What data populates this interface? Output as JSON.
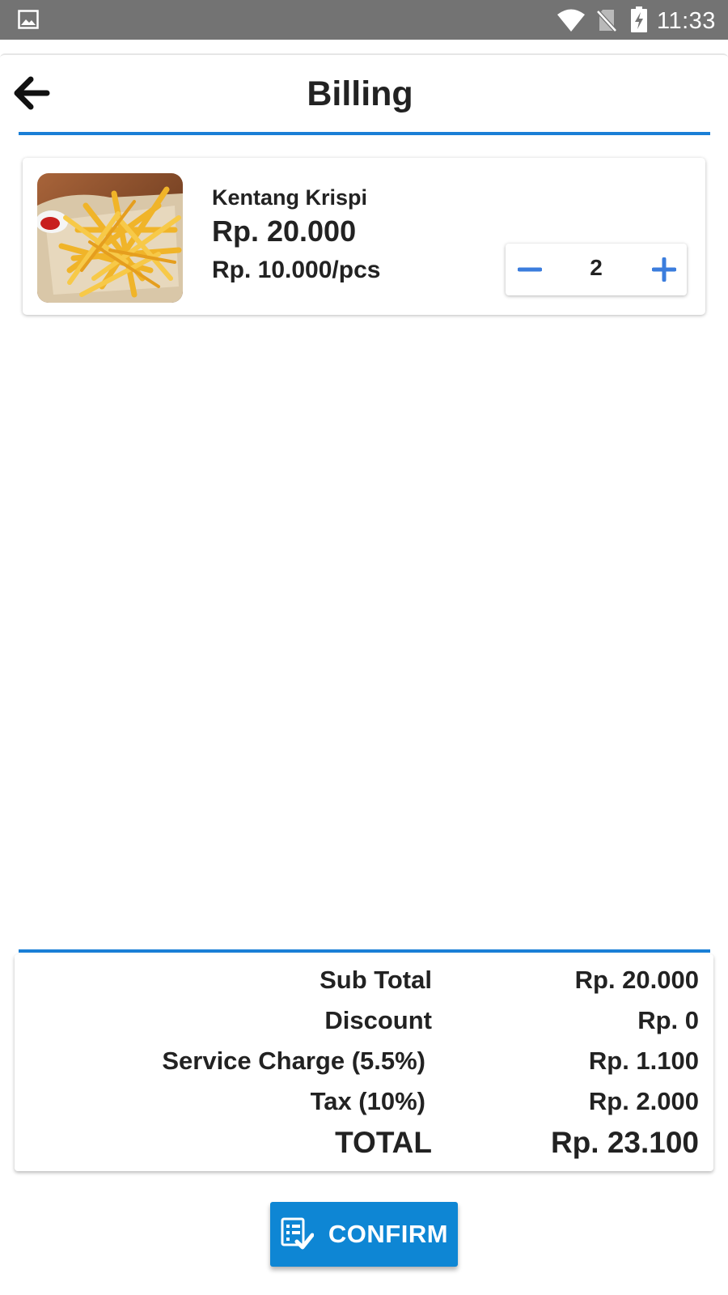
{
  "status_bar": {
    "time": "11:33",
    "icons": [
      "gallery-icon",
      "wifi-icon",
      "no-signal-icon",
      "battery-charging-icon"
    ],
    "background": "#737373"
  },
  "header": {
    "title": "Billing",
    "back_icon": "arrow-left-icon"
  },
  "cart": {
    "items": [
      {
        "name": "Kentang Krispi",
        "total_price": "Rp. 20.000",
        "unit_price": "Rp. 10.000/pcs",
        "quantity": "2",
        "image": "french-fries-photo"
      }
    ]
  },
  "summary": {
    "rows": [
      {
        "label": "Sub Total",
        "value": "Rp. 20.000"
      },
      {
        "label": "Discount",
        "value": "Rp. 0"
      },
      {
        "label": "Service Charge (5.5%)",
        "value": "Rp. 1.100"
      },
      {
        "label": "Tax (10%)",
        "value": "Rp. 2.000"
      }
    ],
    "total": {
      "label": "TOTAL",
      "value": "Rp. 23.100"
    }
  },
  "confirm": {
    "label": "CONFIRM",
    "icon": "checklist-icon"
  },
  "colors": {
    "accent": "#1a7fd6",
    "button": "#0e86d4",
    "stepper": "#3b7ddd",
    "text": "#222222"
  }
}
